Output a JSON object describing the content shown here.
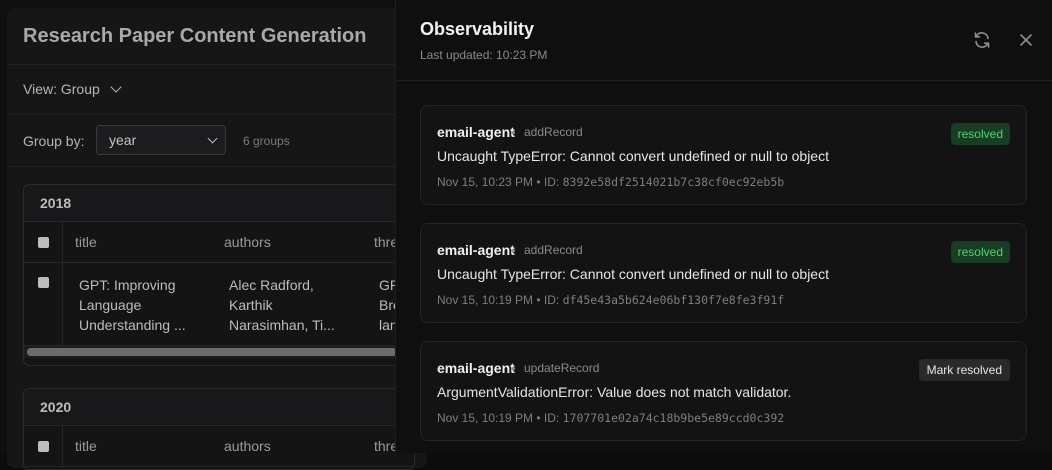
{
  "background": {
    "title": "Research Paper Content Generation",
    "view_label": "View: Group",
    "group_by_label": "Group by:",
    "group_by_value": "year",
    "groups_count": "6 groups",
    "groups": [
      {
        "year": "2018",
        "columns": [
          "title",
          "authors",
          "thre"
        ],
        "rows": [
          {
            "title_lines": [
              "GPT: Improving",
              "Language",
              "Understanding ..."
            ],
            "authors_lines": [
              "Alec Radford,",
              "Karthik",
              "Narasimhan, Ti..."
            ],
            "third_lines": [
              "GP",
              "Bre",
              "lan"
            ]
          }
        ]
      },
      {
        "year": "2020",
        "columns": [
          "title",
          "authors",
          "thre"
        ]
      }
    ]
  },
  "panel": {
    "title": "Observability",
    "last_updated": "Last updated: 10:23 PM",
    "icons": {
      "refresh": "refresh-icon",
      "close": "close-icon"
    },
    "errors": [
      {
        "agent": "email-agent",
        "operation": "addRecord",
        "message": "Uncaught TypeError: Cannot convert undefined or null to object",
        "time": "Nov 15, 10:23 PM • ID:",
        "id": "8392e58df2514021b7c38cf0ec92eb5b",
        "status": "resolved"
      },
      {
        "agent": "email-agent",
        "operation": "addRecord",
        "message": "Uncaught TypeError: Cannot convert undefined or null to object",
        "time": "Nov 15, 10:19 PM • ID:",
        "id": "df45e43a5b624e06bf130f7e8fe3f91f",
        "status": "resolved"
      },
      {
        "agent": "email-agent",
        "operation": "updateRecord",
        "message": "ArgumentValidationError: Value does not match validator.",
        "time": "Nov 15, 10:19 PM • ID:",
        "id": "1707701e02a74c18b9be5e89ccd0c392",
        "action_label": "Mark resolved"
      }
    ],
    "separator": "•"
  },
  "colors": {
    "resolved_bg": "#173d23",
    "resolved_text": "#4ad66d"
  }
}
